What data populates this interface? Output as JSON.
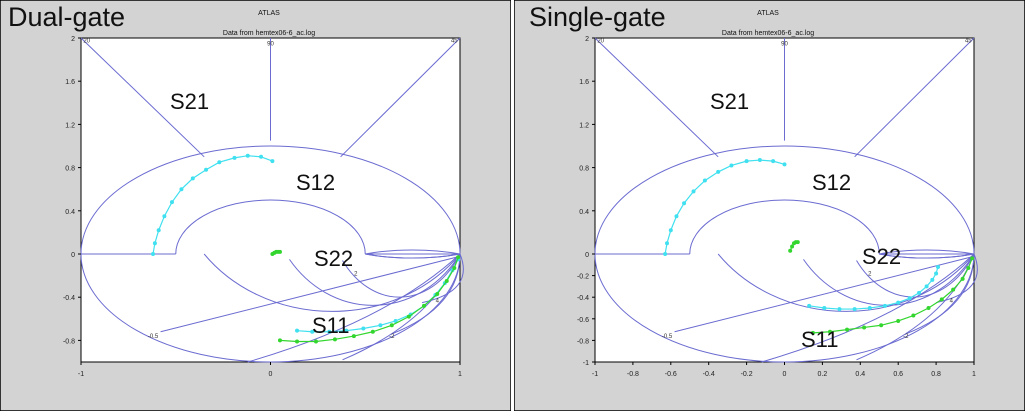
{
  "colors": {
    "panel_bg": "#d3d3d3",
    "plot_bg": "#ffffff",
    "grid": "#6b6bd1",
    "frame": "#000000",
    "s_params_cyan": "#3fe0ef",
    "s_params_green": "#33d62e"
  },
  "panels": [
    {
      "title": "Dual-gate",
      "header": "ATLAS",
      "subheader": "Data from hemtex06-6_ac.log",
      "labels": {
        "s21": "S21",
        "s12": "S12",
        "s22": "S22",
        "s11": "S11"
      },
      "yticks": [
        "2",
        "1.6",
        "1.2",
        "0.8",
        "0.4",
        "0",
        "-0.4",
        "-0.8"
      ],
      "xticks": [
        "-1",
        "0",
        "1"
      ],
      "grid_labels": [
        "20",
        "90",
        "45",
        "2",
        "4",
        "-2",
        "-0.5"
      ]
    },
    {
      "title": "Single-gate",
      "header": "ATLAS",
      "subheader": "Data from hemtex06-6_ac.log",
      "labels": {
        "s21": "S21",
        "s12": "S12",
        "s22": "S22",
        "s11": "S11"
      },
      "yticks": [
        "2",
        "1.6",
        "1.2",
        "0.8",
        "0.4",
        "0",
        "-0.2",
        "-0.4",
        "-0.6",
        "-0.8",
        "-1"
      ],
      "xticks": [
        "-1",
        "-0.8",
        "-0.6",
        "-0.4",
        "-0.2",
        "0",
        "0.2",
        "0.4",
        "0.6",
        "0.8",
        "1"
      ],
      "grid_labels": [
        "20",
        "90",
        "45",
        "2",
        "4",
        "-2",
        "-0.5"
      ]
    }
  ],
  "chart_data": [
    {
      "type": "scatter",
      "title": "ATLAS",
      "subtitle": "Data from hemtex06-6_ac.log",
      "xlim": [
        -1,
        1
      ],
      "ylim": [
        -1.0,
        2.0
      ],
      "series": [
        {
          "name": "S21",
          "color": "#3fe0ef",
          "x": [
            -0.62,
            -0.61,
            -0.59,
            -0.56,
            -0.52,
            -0.47,
            -0.41,
            -0.34,
            -0.27,
            -0.19,
            -0.12,
            -0.05,
            0.01
          ],
          "y": [
            0.0,
            0.1,
            0.22,
            0.35,
            0.48,
            0.6,
            0.7,
            0.78,
            0.85,
            0.89,
            0.91,
            0.9,
            0.86
          ]
        },
        {
          "name": "S12",
          "color": "#33d62e",
          "x": [
            0.01,
            0.02,
            0.03,
            0.04,
            0.05
          ],
          "y": [
            0.0,
            0.01,
            0.02,
            0.02,
            0.02
          ]
        },
        {
          "name": "S22",
          "color": "#3fe0ef",
          "x": [
            0.14,
            0.22,
            0.31,
            0.4,
            0.49,
            0.58,
            0.66,
            0.74,
            0.81,
            0.87,
            0.92,
            0.96,
            0.99
          ],
          "y": [
            -0.71,
            -0.72,
            -0.72,
            -0.71,
            -0.69,
            -0.66,
            -0.62,
            -0.56,
            -0.48,
            -0.38,
            -0.27,
            -0.15,
            -0.05
          ]
        },
        {
          "name": "S11",
          "color": "#33d62e",
          "x": [
            0.05,
            0.14,
            0.24,
            0.34,
            0.44,
            0.54,
            0.64,
            0.73,
            0.81,
            0.88,
            0.93,
            0.97,
            0.99
          ],
          "y": [
            -0.8,
            -0.81,
            -0.81,
            -0.79,
            -0.76,
            -0.72,
            -0.66,
            -0.58,
            -0.48,
            -0.37,
            -0.25,
            -0.13,
            -0.03
          ]
        }
      ]
    },
    {
      "type": "scatter",
      "title": "ATLAS",
      "subtitle": "Data from hemtex06-6_ac.log",
      "xlim": [
        -1,
        1
      ],
      "ylim": [
        -1.0,
        2.0
      ],
      "series": [
        {
          "name": "S21",
          "color": "#3fe0ef",
          "x": [
            -0.63,
            -0.62,
            -0.6,
            -0.57,
            -0.53,
            -0.48,
            -0.42,
            -0.35,
            -0.28,
            -0.2,
            -0.13,
            -0.06,
            0.0
          ],
          "y": [
            0.0,
            0.1,
            0.22,
            0.35,
            0.47,
            0.58,
            0.68,
            0.76,
            0.82,
            0.86,
            0.87,
            0.86,
            0.83
          ]
        },
        {
          "name": "S12",
          "color": "#33d62e",
          "x": [
            0.03,
            0.04,
            0.05,
            0.06,
            0.07
          ],
          "y": [
            0.03,
            0.07,
            0.1,
            0.11,
            0.11
          ]
        },
        {
          "name": "S22",
          "color": "#3fe0ef",
          "x": [
            0.13,
            0.21,
            0.29,
            0.37,
            0.45,
            0.53,
            0.6,
            0.66,
            0.71,
            0.75,
            0.78,
            0.8,
            0.81
          ],
          "y": [
            -0.48,
            -0.5,
            -0.51,
            -0.51,
            -0.5,
            -0.48,
            -0.45,
            -0.41,
            -0.36,
            -0.3,
            -0.24,
            -0.18,
            -0.12
          ]
        },
        {
          "name": "S11",
          "color": "#33d62e",
          "x": [
            0.15,
            0.24,
            0.33,
            0.42,
            0.51,
            0.6,
            0.68,
            0.76,
            0.83,
            0.89,
            0.94,
            0.97,
            0.99
          ],
          "y": [
            -0.73,
            -0.72,
            -0.7,
            -0.68,
            -0.66,
            -0.62,
            -0.57,
            -0.5,
            -0.42,
            -0.33,
            -0.23,
            -0.13,
            -0.04
          ]
        }
      ]
    }
  ]
}
